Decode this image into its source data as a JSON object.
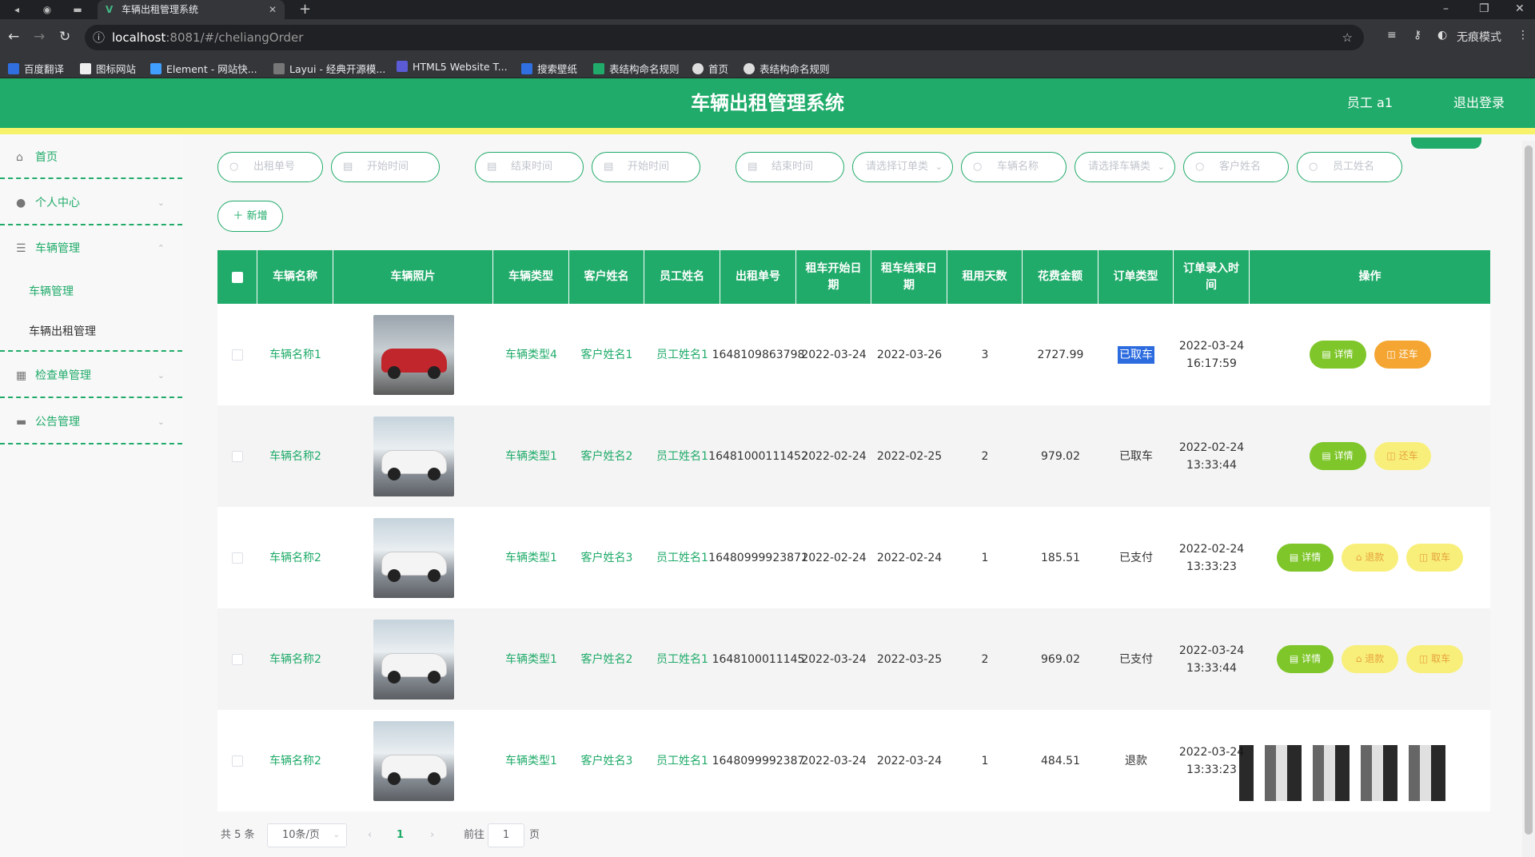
{
  "browser": {
    "tab_title": "车辆出租管理系统",
    "url_host": "localhost",
    "url_path": ":8081/#/cheliangOrder",
    "incognito_label": "无痕模式",
    "bookmarks": [
      "百度翻译",
      "图标网站",
      "Element - 网站快...",
      "Layui - 经典开源模...",
      "HTML5 Website T...",
      "搜索壁纸",
      "表结构命名规则",
      "首页",
      "表结构命名规则"
    ]
  },
  "header": {
    "title": "车辆出租管理系统",
    "user": "员工 a1",
    "logout": "退出登录"
  },
  "sidebar": {
    "home": "首页",
    "personal": "个人中心",
    "vehicle": "车辆管理",
    "sub_vehicle": "车辆管理",
    "sub_rental": "车辆出租管理",
    "inspection": "检查单管理",
    "notice": "公告管理"
  },
  "filters": {
    "order_no": "出租单号",
    "start_time_1": "开始时间",
    "end_time_1": "结束时间",
    "start_time_2": "开始时间",
    "end_time_2": "结束时间",
    "order_type": "请选择订单类",
    "vehicle_name": "车辆名称",
    "vehicle_type": "请选择车辆类",
    "customer_name": "客户姓名",
    "staff_name": "员工姓名"
  },
  "add_button": "新增",
  "table": {
    "headers": [
      "车辆名称",
      "车辆照片",
      "车辆类型",
      "客户姓名",
      "员工姓名",
      "出租单号",
      "租车开始日期",
      "租车结束日期",
      "租用天数",
      "花费金额",
      "订单类型",
      "订单录入时间",
      "操作"
    ],
    "rows": [
      {
        "name": "车辆名称1",
        "type": "车辆类型4",
        "customer": "客户姓名1",
        "staff": "员工姓名1",
        "order_no": "1648109863798",
        "start": "2022-03-24",
        "end": "2022-03-26",
        "days": "3",
        "amount": "2727.99",
        "status": "已取车",
        "time": "2022-03-24 16:17:59",
        "car": "red"
      },
      {
        "name": "车辆名称2",
        "type": "车辆类型1",
        "customer": "客户姓名2",
        "staff": "员工姓名1",
        "order_no": "16481000111452",
        "start": "2022-02-24",
        "end": "2022-02-25",
        "days": "2",
        "amount": "979.02",
        "status": "已取车",
        "time": "2022-02-24 13:33:44",
        "car": "white"
      },
      {
        "name": "车辆名称2",
        "type": "车辆类型1",
        "customer": "客户姓名3",
        "staff": "员工姓名1",
        "order_no": "16480999923871",
        "start": "2022-02-24",
        "end": "2022-02-24",
        "days": "1",
        "amount": "185.51",
        "status": "已支付",
        "time": "2022-02-24 13:33:23",
        "car": "white"
      },
      {
        "name": "车辆名称2",
        "type": "车辆类型1",
        "customer": "客户姓名2",
        "staff": "员工姓名1",
        "order_no": "1648100011145",
        "start": "2022-03-24",
        "end": "2022-03-25",
        "days": "2",
        "amount": "969.02",
        "status": "已支付",
        "time": "2022-03-24 13:33:44",
        "car": "white"
      },
      {
        "name": "车辆名称2",
        "type": "车辆类型1",
        "customer": "客户姓名3",
        "staff": "员工姓名1",
        "order_no": "1648099992387",
        "start": "2022-03-24",
        "end": "2022-03-24",
        "days": "1",
        "amount": "484.51",
        "status": "退款",
        "time": "2022-03-24 13:33:23",
        "car": "white"
      }
    ],
    "actions": {
      "detail": "详情",
      "return": "还车",
      "refund": "退款",
      "pickup": "取车"
    }
  },
  "pagination": {
    "total": "共 5 条",
    "page_size": "10条/页",
    "current": "1",
    "goto_label": "前往",
    "goto_value": "1",
    "page_suffix": "页"
  }
}
